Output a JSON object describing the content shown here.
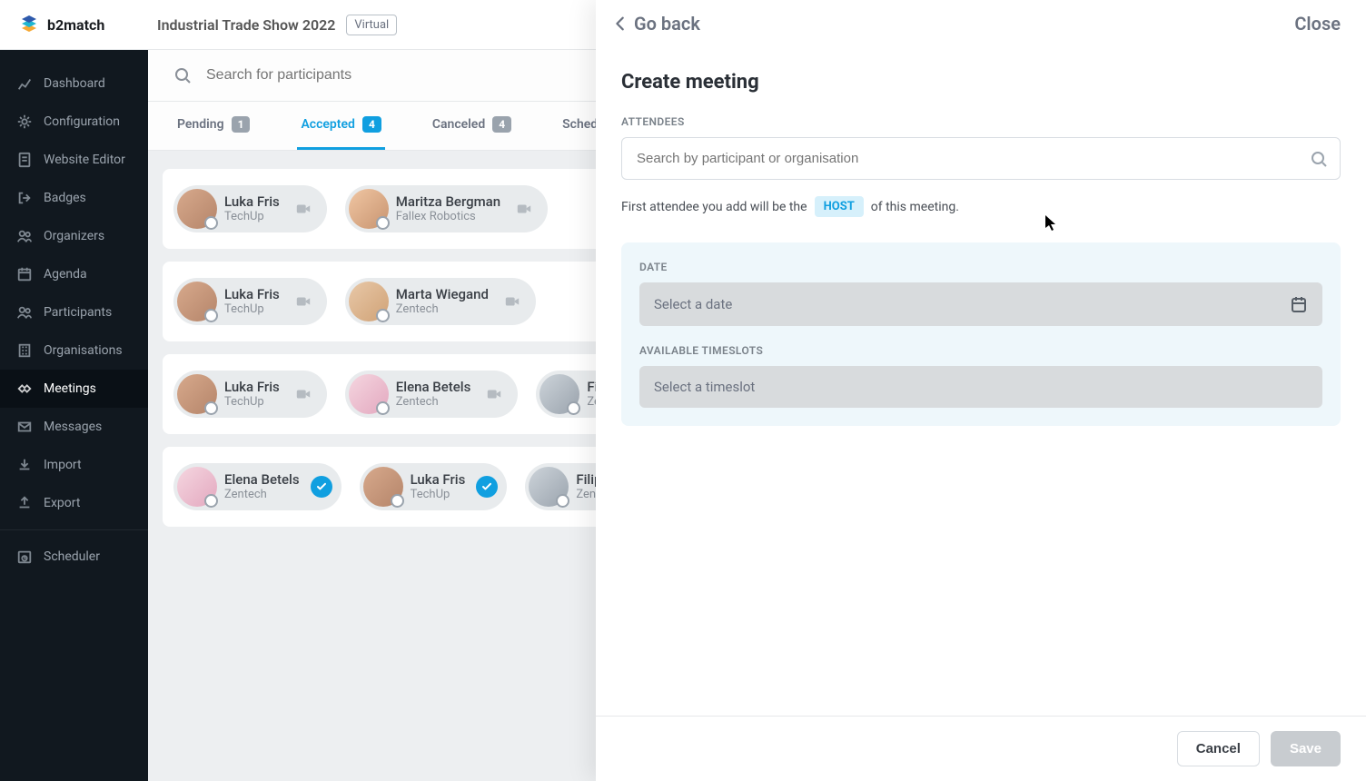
{
  "brand": "b2match",
  "event": {
    "title": "Industrial Trade Show 2022",
    "mode": "Virtual"
  },
  "sidebar": {
    "items": [
      {
        "label": "Dashboard",
        "icon": "chart"
      },
      {
        "label": "Configuration",
        "icon": "gear"
      },
      {
        "label": "Website Editor",
        "icon": "doc"
      },
      {
        "label": "Badges",
        "icon": "logout"
      },
      {
        "label": "Organizers",
        "icon": "users"
      },
      {
        "label": "Agenda",
        "icon": "calendar"
      },
      {
        "label": "Participants",
        "icon": "users"
      },
      {
        "label": "Organisations",
        "icon": "building"
      },
      {
        "label": "Meetings",
        "icon": "handshake"
      },
      {
        "label": "Messages",
        "icon": "mail"
      },
      {
        "label": "Import",
        "icon": "import"
      },
      {
        "label": "Export",
        "icon": "export"
      },
      {
        "label": "Scheduler",
        "icon": "sched"
      }
    ],
    "active_index": 8
  },
  "search": {
    "placeholder": "Search for participants"
  },
  "tabs": [
    {
      "id": "pending",
      "label": "Pending",
      "count": "1"
    },
    {
      "id": "accepted",
      "label": "Accepted",
      "count": "4"
    },
    {
      "id": "canceled",
      "label": "Canceled",
      "count": "4"
    },
    {
      "id": "scheduled",
      "label": "Scheduled",
      "count": ""
    }
  ],
  "active_tab": "accepted",
  "meetings": [
    {
      "chips": [
        {
          "name": "Luka Fris",
          "org": "TechUp",
          "status": "video",
          "av": "m0"
        },
        {
          "name": "Maritza Bergman",
          "org": "Fallex Robotics",
          "status": "video",
          "av": "f0"
        }
      ]
    },
    {
      "chips": [
        {
          "name": "Luka Fris",
          "org": "TechUp",
          "status": "video",
          "av": "m0"
        },
        {
          "name": "Marta Wiegand",
          "org": "Zentech",
          "status": "video",
          "av": "f2"
        }
      ]
    },
    {
      "chips": [
        {
          "name": "Luka Fris",
          "org": "TechUp",
          "status": "video",
          "av": "m0"
        },
        {
          "name": "Elena Betels",
          "org": "Zentech",
          "status": "video",
          "av": "f1"
        },
        {
          "name": "Filip Edwards",
          "org": "Zentech",
          "status": "video",
          "av": "f3"
        }
      ]
    },
    {
      "chips": [
        {
          "name": "Elena Betels",
          "org": "Zentech",
          "status": "check",
          "av": "f1"
        },
        {
          "name": "Luka Fris",
          "org": "TechUp",
          "status": "check",
          "av": "m0"
        },
        {
          "name": "Filip Edwards",
          "org": "Zentech",
          "status": "check",
          "av": "f3"
        }
      ]
    }
  ],
  "panel": {
    "go_back": "Go back",
    "close": "Close",
    "title": "Create meeting",
    "attendees_label": "ATTENDEES",
    "search_placeholder": "Search by participant or organisation",
    "note_before": "First attendee you add will be the",
    "note_host": "HOST",
    "note_after": "of this meeting.",
    "date_label": "DATE",
    "date_placeholder": "Select a date",
    "slots_label": "AVAILABLE TIMESLOTS",
    "slot_placeholder": "Select a timeslot",
    "cancel": "Cancel",
    "save": "Save"
  }
}
